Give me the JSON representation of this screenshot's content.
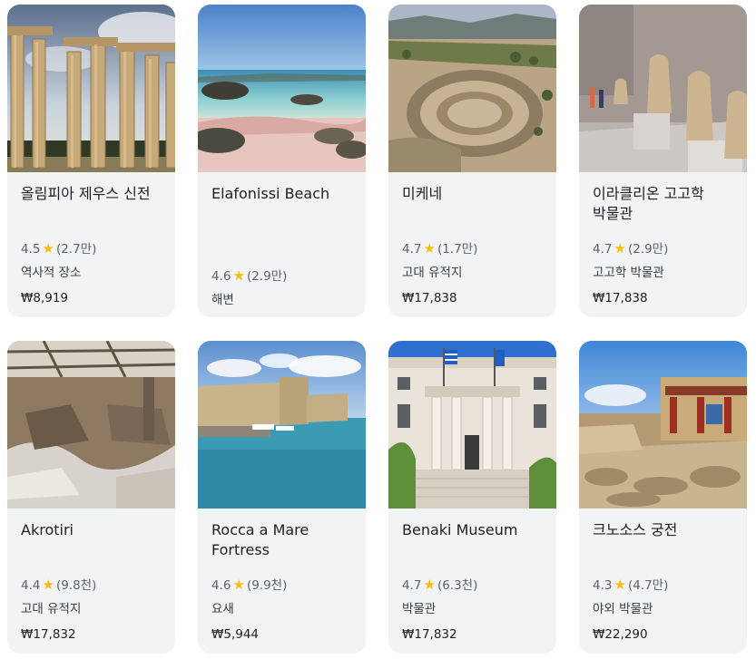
{
  "cards": [
    {
      "name": "올림피아 제우스 신전",
      "rating": "4.5",
      "reviews": "(2.7만)",
      "category": "역사적 장소",
      "price": "₩8,919"
    },
    {
      "name": "Elafonissi Beach",
      "rating": "4.6",
      "reviews": "(2.9만)",
      "category": "해변",
      "price": ""
    },
    {
      "name": "미케네",
      "rating": "4.7",
      "reviews": "(1.7만)",
      "category": "고대 유적지",
      "price": "₩17,838"
    },
    {
      "name": "이라클리온 고고학 박물관",
      "rating": "4.7",
      "reviews": "(2.9만)",
      "category": "고고학 박물관",
      "price": "₩17,838"
    },
    {
      "name": "Akrotiri",
      "rating": "4.4",
      "reviews": "(9.8천)",
      "category": "고대 유적지",
      "price": "₩17,832"
    },
    {
      "name": "Rocca a Mare Fortress",
      "rating": "4.6",
      "reviews": "(9.9천)",
      "category": "요새",
      "price": "₩5,944"
    },
    {
      "name": "Benaki Museum",
      "rating": "4.7",
      "reviews": "(6.3천)",
      "category": "박물관",
      "price": "₩17,832"
    },
    {
      "name": "크노소스 궁전",
      "rating": "4.3",
      "reviews": "(4.7만)",
      "category": "야외 박물관",
      "price": "₩22,290"
    }
  ]
}
